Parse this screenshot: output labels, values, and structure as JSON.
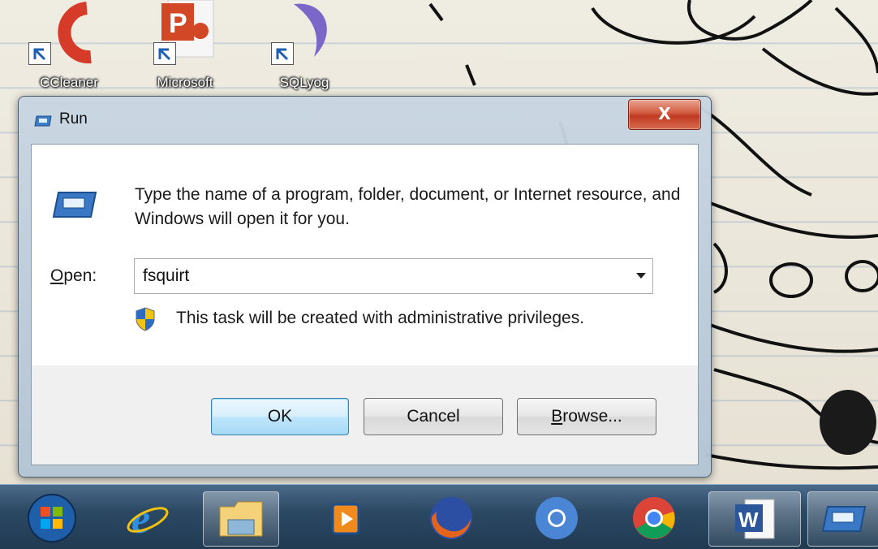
{
  "desktop": {
    "icons": [
      {
        "label": "CCleaner",
        "icon": "ccleaner-icon"
      },
      {
        "label": "Microsoft",
        "icon": "powerpoint-icon"
      },
      {
        "label": "SQLyog",
        "icon": "sqlyog-icon"
      }
    ]
  },
  "dialog": {
    "title": "Run",
    "close_label": "X",
    "description": "Type the name of a program, folder, document, or Internet resource, and Windows will open it for you.",
    "open_label_key": "O",
    "open_label_rest": "pen:",
    "open_value": "fsquirt",
    "admin_note": "This task will be created with administrative privileges.",
    "buttons": {
      "ok": "OK",
      "cancel": "Cancel",
      "browse_key": "B",
      "browse_rest": "rowse..."
    }
  },
  "taskbar": {
    "items": [
      {
        "icon": "start-orb-icon"
      },
      {
        "icon": "internet-explorer-icon"
      },
      {
        "icon": "file-explorer-icon",
        "active": true
      },
      {
        "icon": "media-player-icon"
      },
      {
        "icon": "firefox-icon"
      },
      {
        "icon": "chrome-blue-icon"
      },
      {
        "icon": "chrome-icon"
      },
      {
        "icon": "word-icon",
        "active": true
      },
      {
        "icon": "run-icon",
        "active": true
      }
    ]
  },
  "colors": {
    "ok_border": "#3c7fb1",
    "close_red": "#c03a22",
    "taskbar": "#2c4964"
  }
}
